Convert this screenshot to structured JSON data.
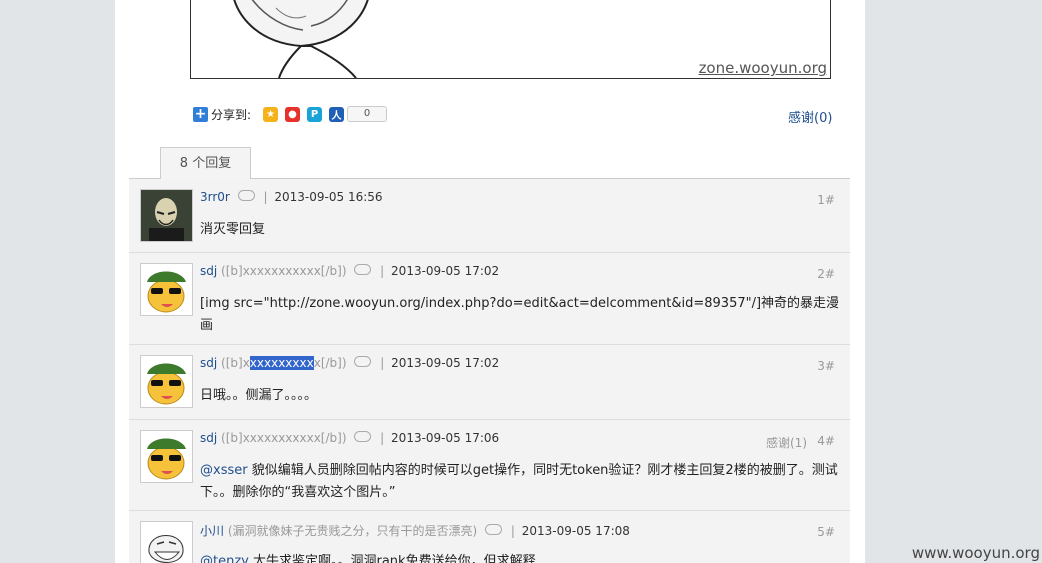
{
  "comic": {
    "watermark": "zone.wooyun.org"
  },
  "share": {
    "label": "分享到:",
    "count": "0",
    "icons": [
      "qzone-icon",
      "weibo-icon",
      "tencent-weibo-icon",
      "renren-icon"
    ]
  },
  "thanks_top": "感谢(0)",
  "replies_tab": "8 个回复",
  "replies": [
    {
      "user": "3rr0r",
      "signature": "",
      "time": "2013-09-05 16:56",
      "floor": "1#",
      "thanks": "",
      "content": "消灭零回复"
    },
    {
      "user": "sdj",
      "signature": "([b]xxxxxxxxxxx[/b])",
      "time": "2013-09-05 17:02",
      "floor": "2#",
      "thanks": "",
      "content": "[img src=\"http://zone.wooyun.org/index.php?do=edit&act=delcomment&id=89357\"/]神奇的暴走漫画"
    },
    {
      "user": "sdj",
      "signature_pre": "([b]x",
      "signature_selected": "xxxxxxxxx",
      "signature_post": "x[/b])",
      "time": "2013-09-05 17:02",
      "floor": "3#",
      "thanks": "",
      "content": "日哦。。侧漏了。。。。"
    },
    {
      "user": "sdj",
      "signature": "([b]xxxxxxxxxxx[/b])",
      "time": "2013-09-05 17:06",
      "floor": "4#",
      "thanks": "感谢(1)",
      "mention": "@xsser",
      "content": " 貌似编辑人员删除回帖内容的时候可以get操作，同时无token验证？刚才楼主回复2楼的被删了。测试下。。删除你的“我喜欢这个图片。”"
    },
    {
      "user": "小川",
      "signature": "(漏洞就像妹子无贵贱之分，只有干的是否漂亮)",
      "time": "2013-09-05 17:08",
      "floor": "5#",
      "thanks": "",
      "mention": "@tenzy",
      "content": " 大牛求鉴定啊。。洞洞rank免费送给你，但求解释"
    }
  ],
  "footer_watermark": "www.wooyun.org",
  "colors": {
    "link": "#1f4e8c",
    "muted": "#999999",
    "reply_bg": "#f3f3f3",
    "page_bg": "#e2e5e8",
    "selection": "#3366cc"
  }
}
